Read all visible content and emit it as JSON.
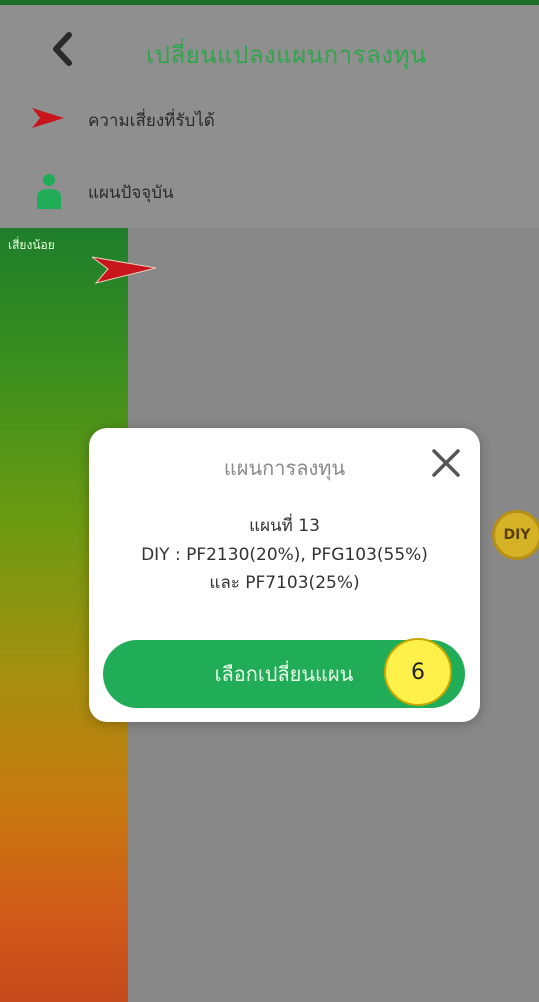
{
  "header": {
    "title": "เปลี่ยนแปลงแผนการลงทุน"
  },
  "legend": {
    "risk_label": "ความเสี่ยงที่รับได้",
    "current_plan_label": "แผนปัจจุบัน"
  },
  "chart": {
    "low_risk_label": "เสี่ยงน้อย",
    "diy_badge": "DIY"
  },
  "modal": {
    "title": "แผนการลงทุน",
    "plan_number": "แผนที่ 13",
    "plan_line1": "DIY : PF2130(20%), PFG103(55%)",
    "plan_line2": "และ PF7103(25%)",
    "cta_label": "เลือกเปลี่ยนแผน"
  },
  "annotation": {
    "step_number": "6"
  },
  "colors": {
    "accent_green": "#21ad57",
    "title_green": "#2fa64b",
    "risk_marker_red": "#c8151b",
    "badge_gold": "#d6b326",
    "step_yellow": "#fff14a"
  },
  "icons": {
    "back": "chevron-left-icon",
    "risk": "red-arrow-icon",
    "current_plan": "person-icon",
    "close": "close-icon"
  }
}
